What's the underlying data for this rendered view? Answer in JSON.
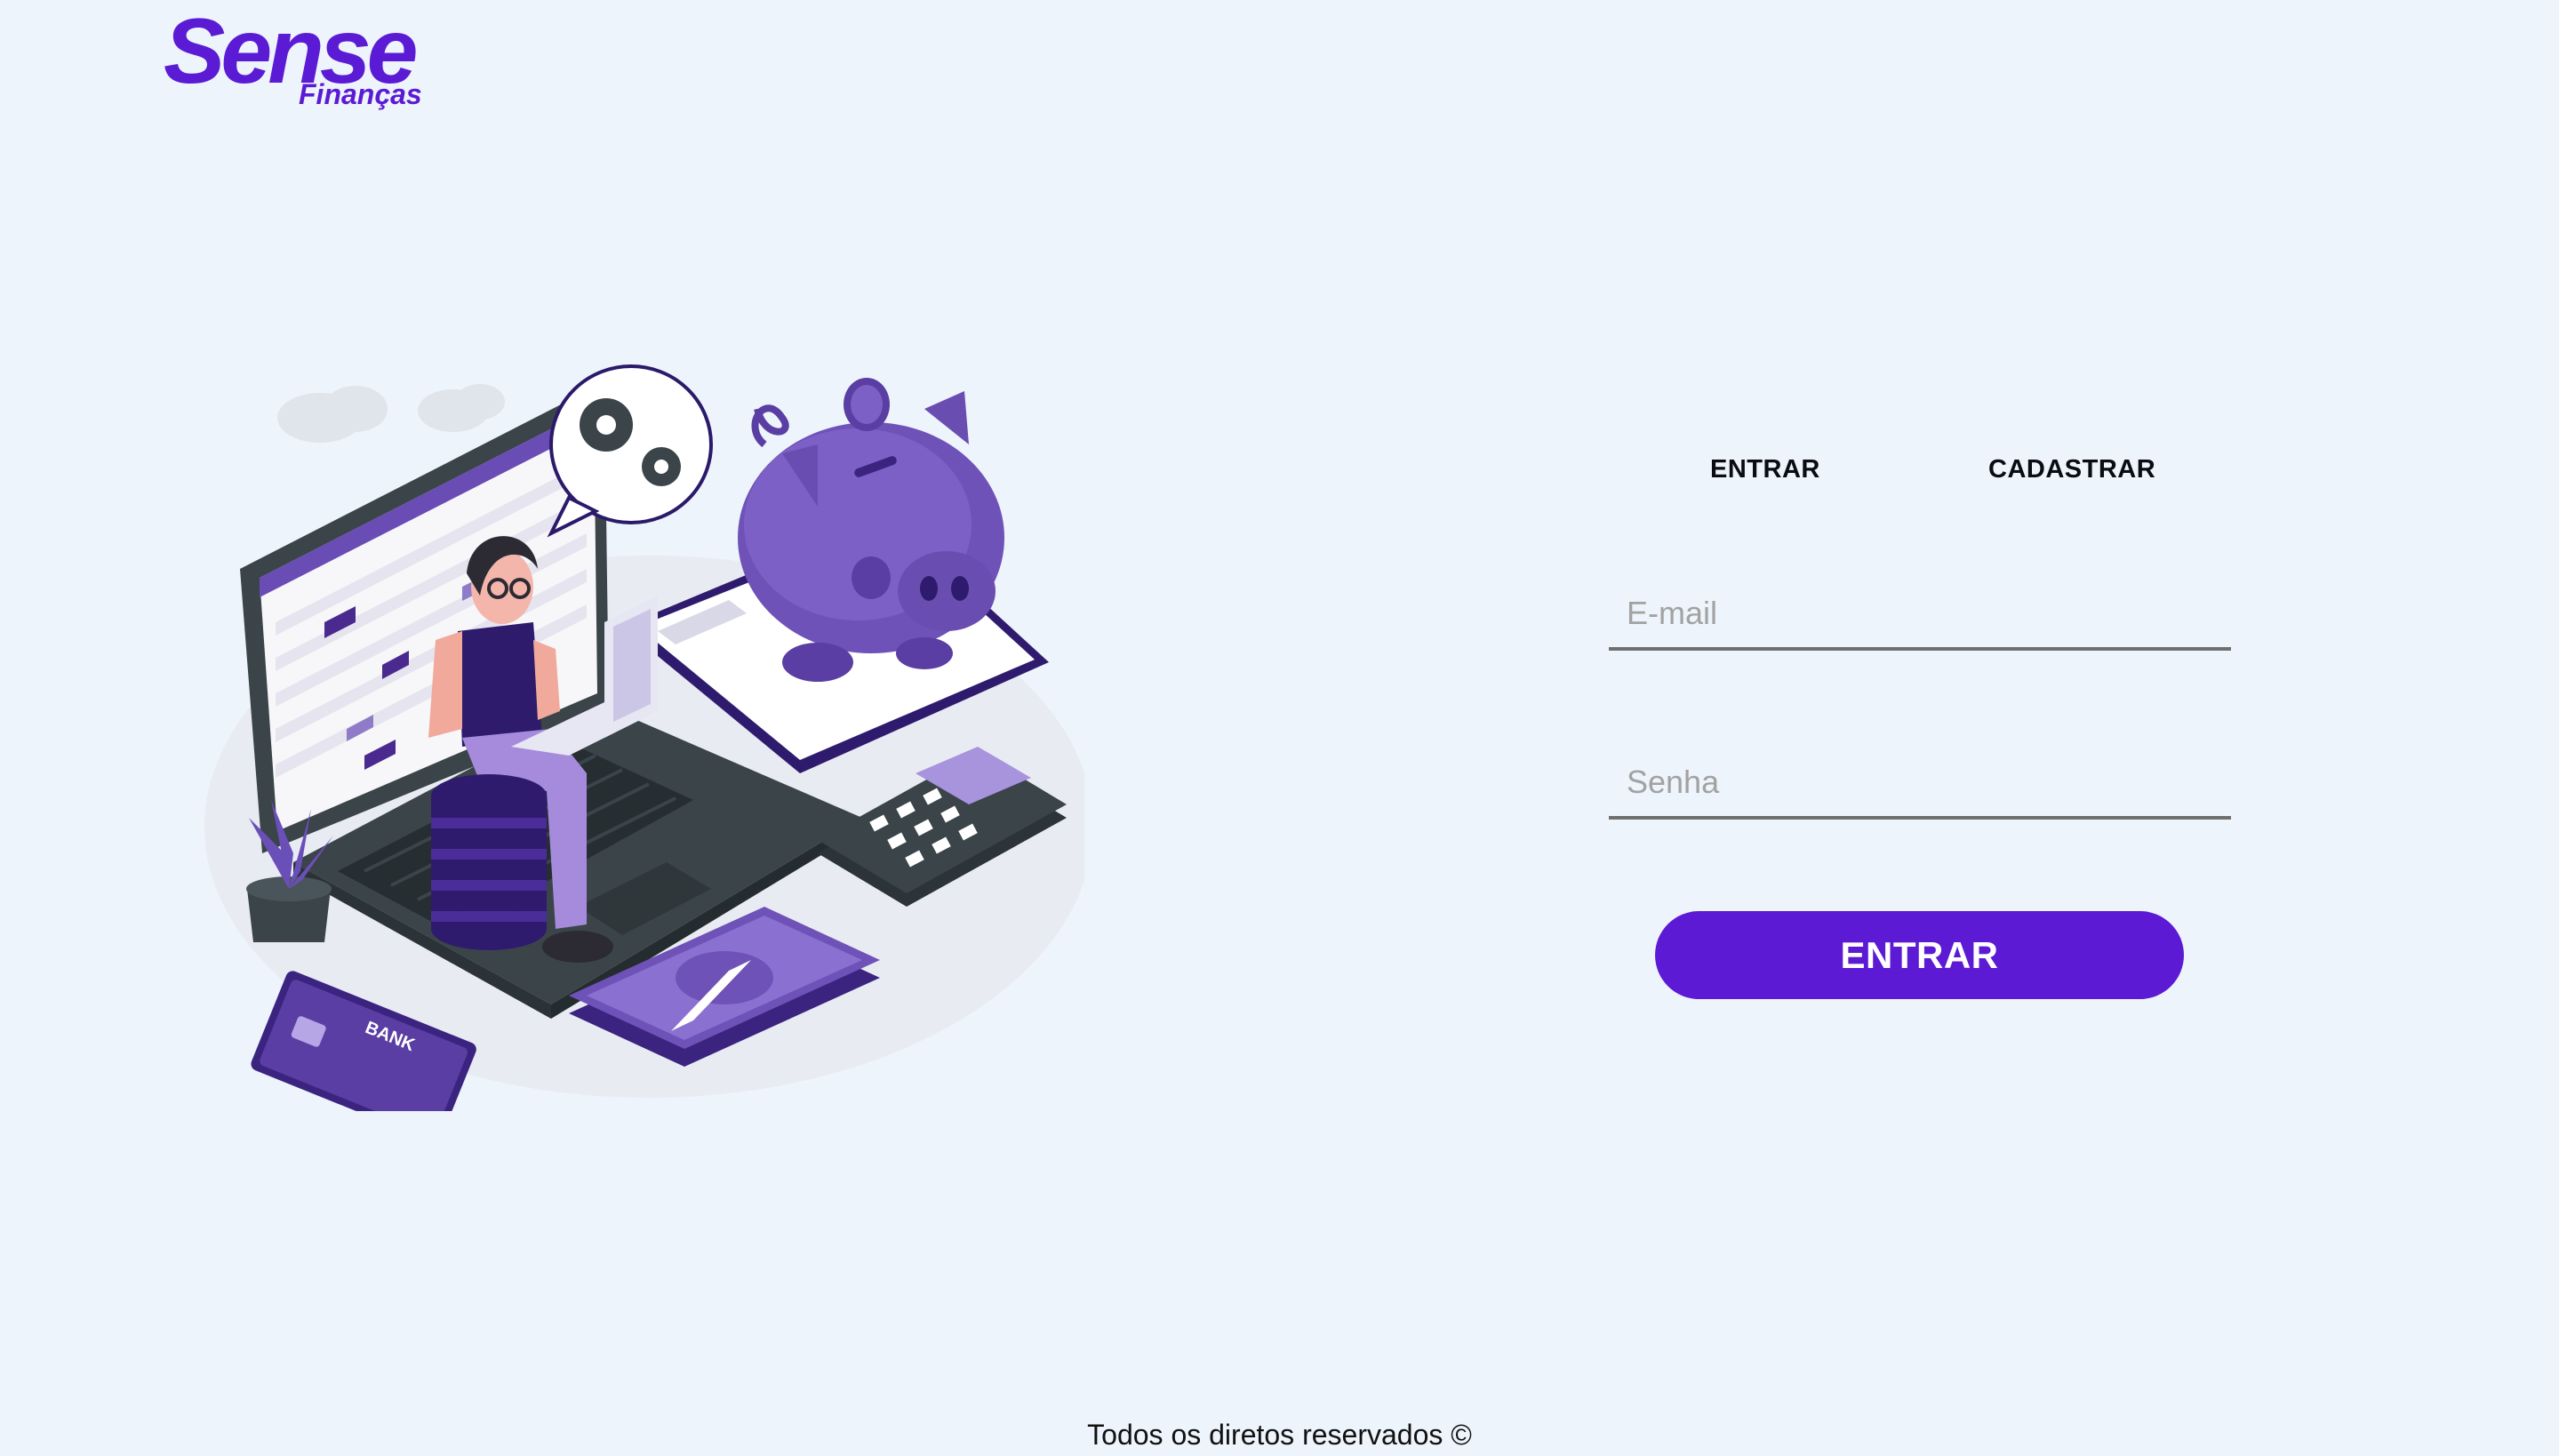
{
  "brand": {
    "name": "Sense",
    "tagline": "Finanças",
    "color": "#5b1bd4"
  },
  "illustration": {
    "card_label": "BANK",
    "icon": "finance-illustration"
  },
  "auth": {
    "tabs": [
      {
        "label": "ENTRAR"
      },
      {
        "label": "CADASTRAR"
      }
    ],
    "email_placeholder": "E-mail",
    "password_placeholder": "Senha",
    "submit_label": "ENTRAR",
    "accent": "#5c1ad4"
  },
  "footer": {
    "text": "Todos os diretos reservados ©"
  }
}
